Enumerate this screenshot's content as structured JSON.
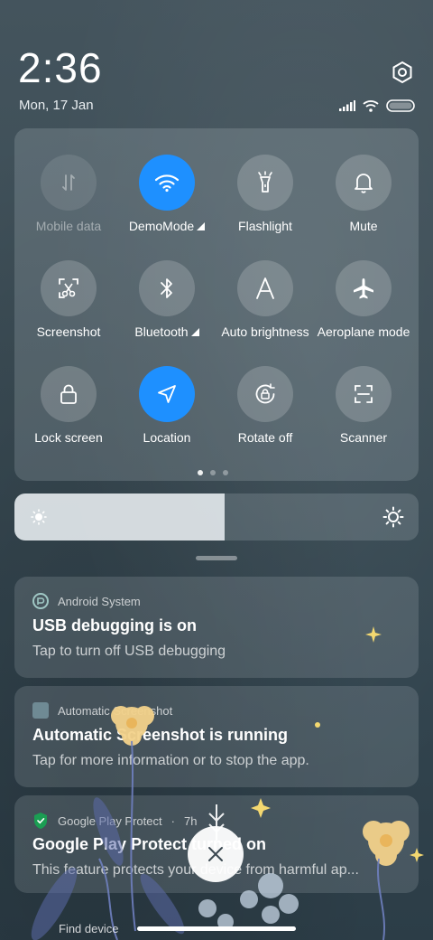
{
  "header": {
    "time": "2:36",
    "date": "Mon, 17 Jan"
  },
  "status_icons": [
    "signal-icon",
    "wifi-icon",
    "battery-icon"
  ],
  "quick_settings": {
    "tiles": [
      {
        "label": "Mobile data",
        "icon": "mobile-data-icon",
        "state": "disabled"
      },
      {
        "label": "DemoMode",
        "icon": "wifi-icon",
        "state": "active",
        "expandable": true
      },
      {
        "label": "Flashlight",
        "icon": "flashlight-icon",
        "state": "off"
      },
      {
        "label": "Mute",
        "icon": "bell-icon",
        "state": "off"
      },
      {
        "label": "Screenshot",
        "icon": "screenshot-icon",
        "state": "off"
      },
      {
        "label": "Bluetooth",
        "icon": "bluetooth-icon",
        "state": "off",
        "expandable": true
      },
      {
        "label": "Auto brightness",
        "icon": "auto-brightness-icon",
        "state": "off"
      },
      {
        "label": "Aeroplane mode",
        "icon": "airplane-icon",
        "state": "off"
      },
      {
        "label": "Lock screen",
        "icon": "lock-icon",
        "state": "off"
      },
      {
        "label": "Location",
        "icon": "location-icon",
        "state": "active"
      },
      {
        "label": "Rotate off",
        "icon": "rotate-lock-icon",
        "state": "off"
      },
      {
        "label": "Scanner",
        "icon": "scanner-icon",
        "state": "off"
      }
    ],
    "page_count": 3,
    "current_page": 1
  },
  "brightness": {
    "level": 0.52
  },
  "notifications": [
    {
      "app": "Android System",
      "title": "USB debugging is on",
      "body": "Tap to turn off USB debugging"
    },
    {
      "app": "Automatic Screenshot",
      "title": "Automatic Screenshot is running",
      "body": "Tap for more information or to stop the app."
    },
    {
      "app": "Google Play Protect",
      "time": "7h",
      "title": "Google Play Protect turned on",
      "body": "This feature protects your device from harmful ap..."
    }
  ],
  "peek": {
    "label": "Find device"
  },
  "colors": {
    "accent": "#1e90ff",
    "background": "#3b4c55"
  }
}
